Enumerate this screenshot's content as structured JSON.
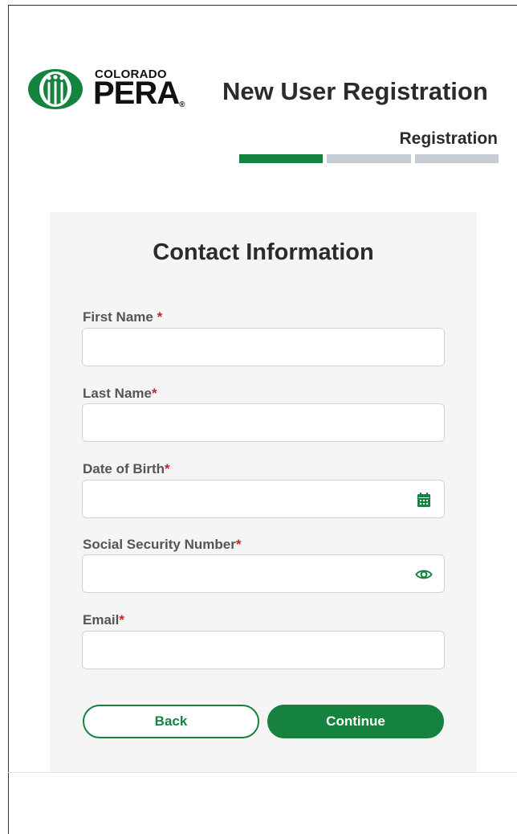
{
  "header": {
    "logo_top": "COLORADO",
    "logo_main": "PERA",
    "logo_reg": "®",
    "title": "New User Registration",
    "step_label": "Registration",
    "progress": {
      "total_steps": 3,
      "current_step": 1
    }
  },
  "form": {
    "title": "Contact Information",
    "required_marker": "*",
    "fields": [
      {
        "label": "First Name ",
        "value": "",
        "placeholder": ""
      },
      {
        "label": "Last Name",
        "value": "",
        "placeholder": ""
      },
      {
        "label": "Date of Birth",
        "value": "",
        "placeholder": "",
        "icon": "calendar-icon"
      },
      {
        "label": "Social Security Number",
        "value": "",
        "placeholder": "",
        "icon": "eye-icon"
      },
      {
        "label": "Email",
        "value": "",
        "placeholder": ""
      }
    ],
    "back_label": "Back",
    "continue_label": "Continue"
  },
  "colors": {
    "brand_green": "#15823f",
    "required_red": "#c0272d",
    "progress_inactive": "#c5ccd3"
  }
}
